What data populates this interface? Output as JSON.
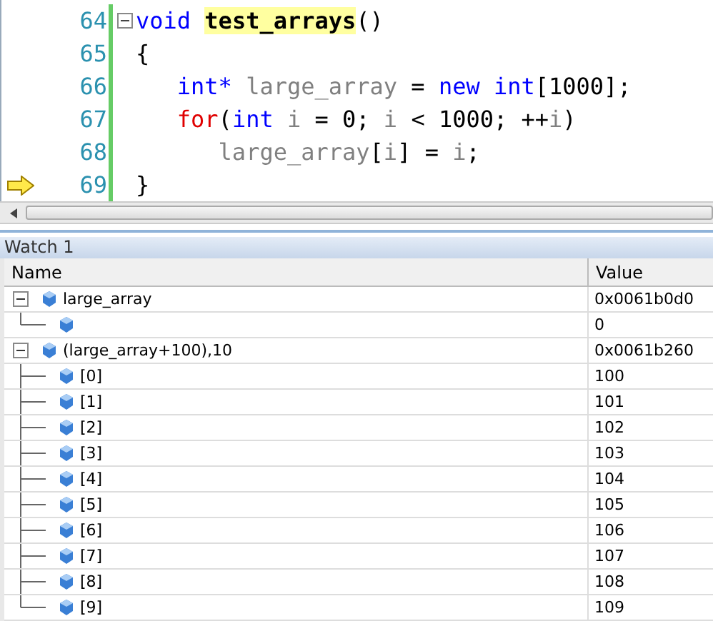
{
  "editor": {
    "lines": [
      {
        "number": "64",
        "fold": true,
        "current": false,
        "tokens": [
          {
            "text": "void ",
            "kind": "keyword"
          },
          {
            "text": "test_arrays",
            "kind": "function"
          },
          {
            "text": "()",
            "kind": "plain"
          }
        ]
      },
      {
        "number": "65",
        "fold": false,
        "current": false,
        "tokens": [
          {
            "text": "{",
            "kind": "plain"
          }
        ]
      },
      {
        "number": "66",
        "fold": false,
        "current": false,
        "tokens": [
          {
            "text": "   int*",
            "kind": "keyword"
          },
          {
            "text": " large_array ",
            "kind": "identifier"
          },
          {
            "text": "= ",
            "kind": "plain"
          },
          {
            "text": "new int",
            "kind": "keyword"
          },
          {
            "text": "[1000];",
            "kind": "plain"
          }
        ]
      },
      {
        "number": "67",
        "fold": false,
        "current": false,
        "tokens": [
          {
            "text": "   for",
            "kind": "control"
          },
          {
            "text": "(",
            "kind": "plain"
          },
          {
            "text": "int",
            "kind": "keyword"
          },
          {
            "text": " i ",
            "kind": "identifier"
          },
          {
            "text": "= 0; ",
            "kind": "plain"
          },
          {
            "text": "i",
            "kind": "identifier"
          },
          {
            "text": " < 1000; ++",
            "kind": "plain"
          },
          {
            "text": "i",
            "kind": "identifier"
          },
          {
            "text": ")",
            "kind": "plain"
          }
        ]
      },
      {
        "number": "68",
        "fold": false,
        "current": false,
        "tokens": [
          {
            "text": "      large_array",
            "kind": "identifier"
          },
          {
            "text": "[",
            "kind": "plain"
          },
          {
            "text": "i",
            "kind": "identifier"
          },
          {
            "text": "] = ",
            "kind": "plain"
          },
          {
            "text": "i",
            "kind": "identifier"
          },
          {
            "text": ";",
            "kind": "plain"
          }
        ]
      },
      {
        "number": "69",
        "fold": false,
        "current": true,
        "tokens": [
          {
            "text": "}",
            "kind": "plain"
          }
        ]
      }
    ]
  },
  "watch": {
    "title": "Watch 1",
    "columns": [
      "Name",
      "Value"
    ],
    "rows": [
      {
        "name": "large_array",
        "value": "0x0061b0d0",
        "expanded": true,
        "children": [
          {
            "value": "0"
          }
        ]
      },
      {
        "name": "(large_array+100),10",
        "value": "0x0061b260",
        "expanded": true,
        "children": [
          {
            "name": "[0]",
            "value": "100"
          },
          {
            "name": "[1]",
            "value": "101"
          },
          {
            "name": "[2]",
            "value": "102"
          },
          {
            "name": "[3]",
            "value": "103"
          },
          {
            "name": "[4]",
            "value": "104"
          },
          {
            "name": "[5]",
            "value": "105"
          },
          {
            "name": "[6]",
            "value": "106"
          },
          {
            "name": "[7]",
            "value": "107"
          },
          {
            "name": "[8]",
            "value": "108"
          },
          {
            "name": "[9]",
            "value": "109"
          }
        ]
      }
    ]
  }
}
